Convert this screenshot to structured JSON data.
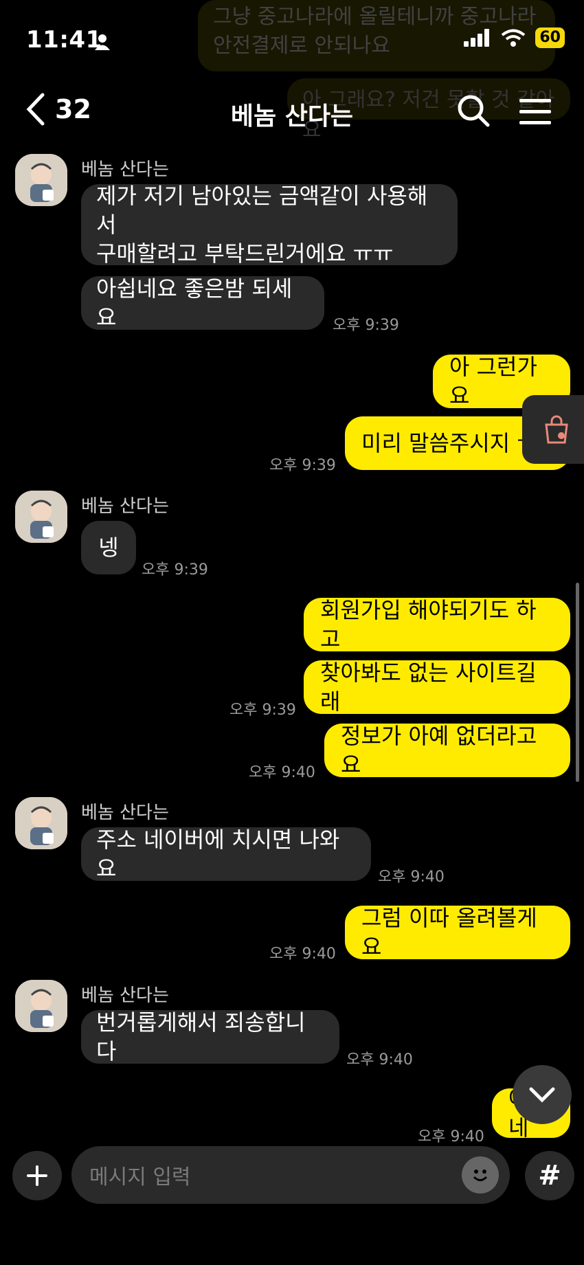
{
  "status_bar": {
    "time": "11:41",
    "battery": "60"
  },
  "header": {
    "back_count": "32",
    "title": "베놈 산다는"
  },
  "ghost": {
    "line1": "그냥 중고나라에 올릴테니까 중고나라",
    "line2": "안전결제로 안되나요",
    "line3": "아 그래요? 저건 못할 것 같아요"
  },
  "chat": {
    "sender": "베놈 산다는",
    "m1_line1": "제가 저기 남아있는 금액같이 사용해서",
    "m1_line2": "구매할려고 부탁드린거에요 ㅠㅠ",
    "m2": "아쉽네요 좋은밤 되세요",
    "t2": "오후 9:39",
    "o1": "아 그런가요",
    "o2": "미리 말씀주시지 ㅠ",
    "to2": "오후 9:39",
    "m3": "넹",
    "t3": "오후 9:39",
    "o3": "회원가입 해야되기도 하고",
    "o4": "찾아봐도 없는 사이트길래",
    "to4": "오후 9:39",
    "o5": "정보가 아예 없더라고요",
    "to5": "오후 9:40",
    "m4": "주소 네이버에 치시면 나와요",
    "t4": "오후 9:40",
    "o6": "그럼 이따 올려볼게요",
    "to6": "오후 9:40",
    "m5": "번거롭게해서 죄송합니다",
    "t5": "오후 9:40",
    "o7": "아 네",
    "to7": "오후 9:40"
  },
  "input": {
    "placeholder": "메시지 입력"
  },
  "icons": {
    "back": "chevron-left-icon",
    "search": "search-icon",
    "menu": "hamburger-icon",
    "shop": "shopping-bag-icon",
    "down": "chevron-down-icon",
    "plus": "plus-icon",
    "emoji": "emoji-icon",
    "hash": "hashtag-icon"
  },
  "colors": {
    "outgoing": "#ffeb00",
    "incoming": "#2a2a2a",
    "background": "#000000"
  }
}
